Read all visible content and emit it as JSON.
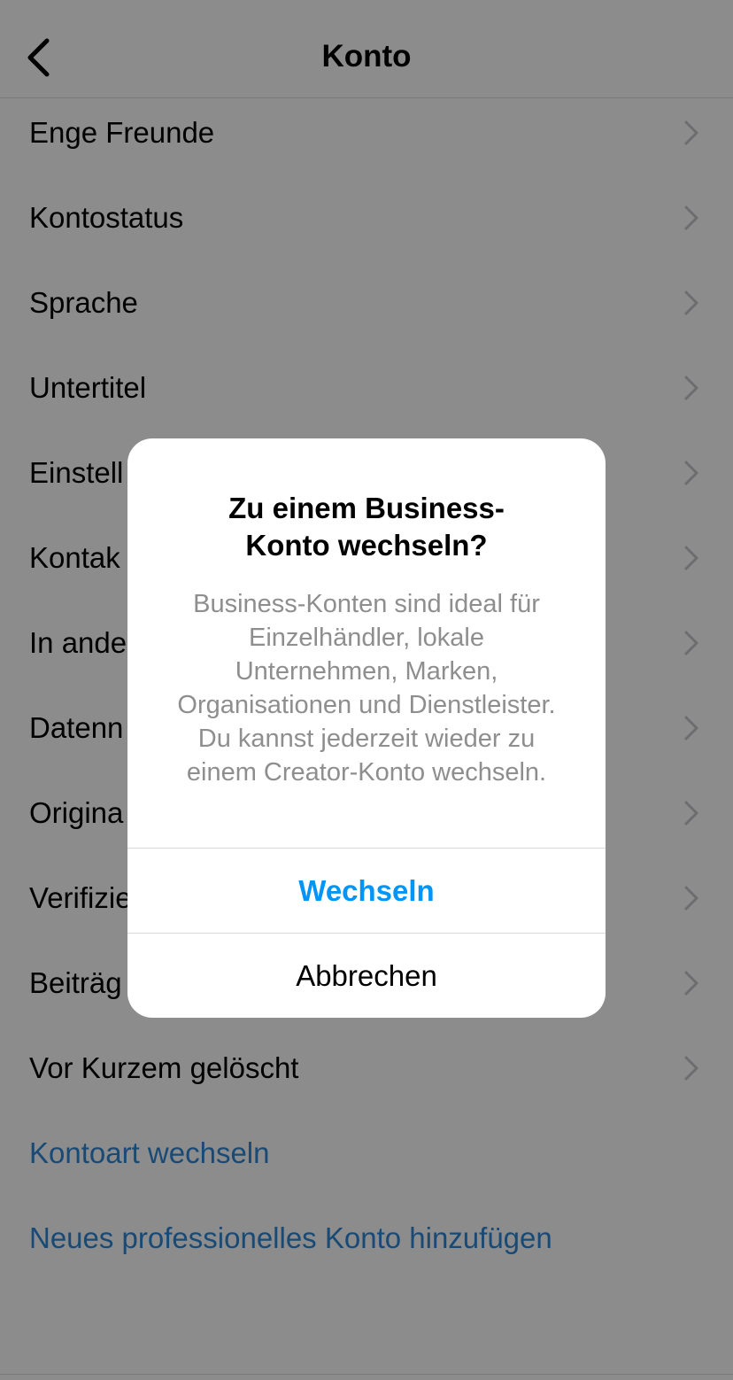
{
  "header": {
    "title": "Konto"
  },
  "menu": {
    "items": [
      {
        "label": "Enge Freunde"
      },
      {
        "label": "Kontostatus"
      },
      {
        "label": "Sprache"
      },
      {
        "label": "Untertitel"
      },
      {
        "label": "Einstell"
      },
      {
        "label": "Kontak"
      },
      {
        "label": "In ande"
      },
      {
        "label": "Datenn"
      },
      {
        "label": "Origina"
      },
      {
        "label": "Verifizie"
      },
      {
        "label": "Beiträg"
      },
      {
        "label": "Vor Kurzem gelöscht"
      }
    ],
    "links": [
      {
        "label": "Kontoart wechseln"
      },
      {
        "label": "Neues professionelles Konto hinzufügen"
      }
    ]
  },
  "dialog": {
    "title_line1": "Zu einem Business-",
    "title_line2": "Konto wechseln?",
    "body_lines": [
      "Business-Konten sind ideal für",
      "Einzelhändler, lokale",
      "Unternehmen, Marken,",
      "Organisationen und Dienstleister.",
      "Du kannst jederzeit wieder zu",
      "einem Creator-Konto wechseln."
    ],
    "confirm_label": "Wechseln",
    "cancel_label": "Abbrechen"
  },
  "colors": {
    "accent_blue": "#0095f6",
    "link_blue": "#2f88d6",
    "overlay": "rgba(0,0,0,0.45)"
  },
  "icons": {
    "back": "chevron-left-icon",
    "row": "chevron-right-icon"
  }
}
